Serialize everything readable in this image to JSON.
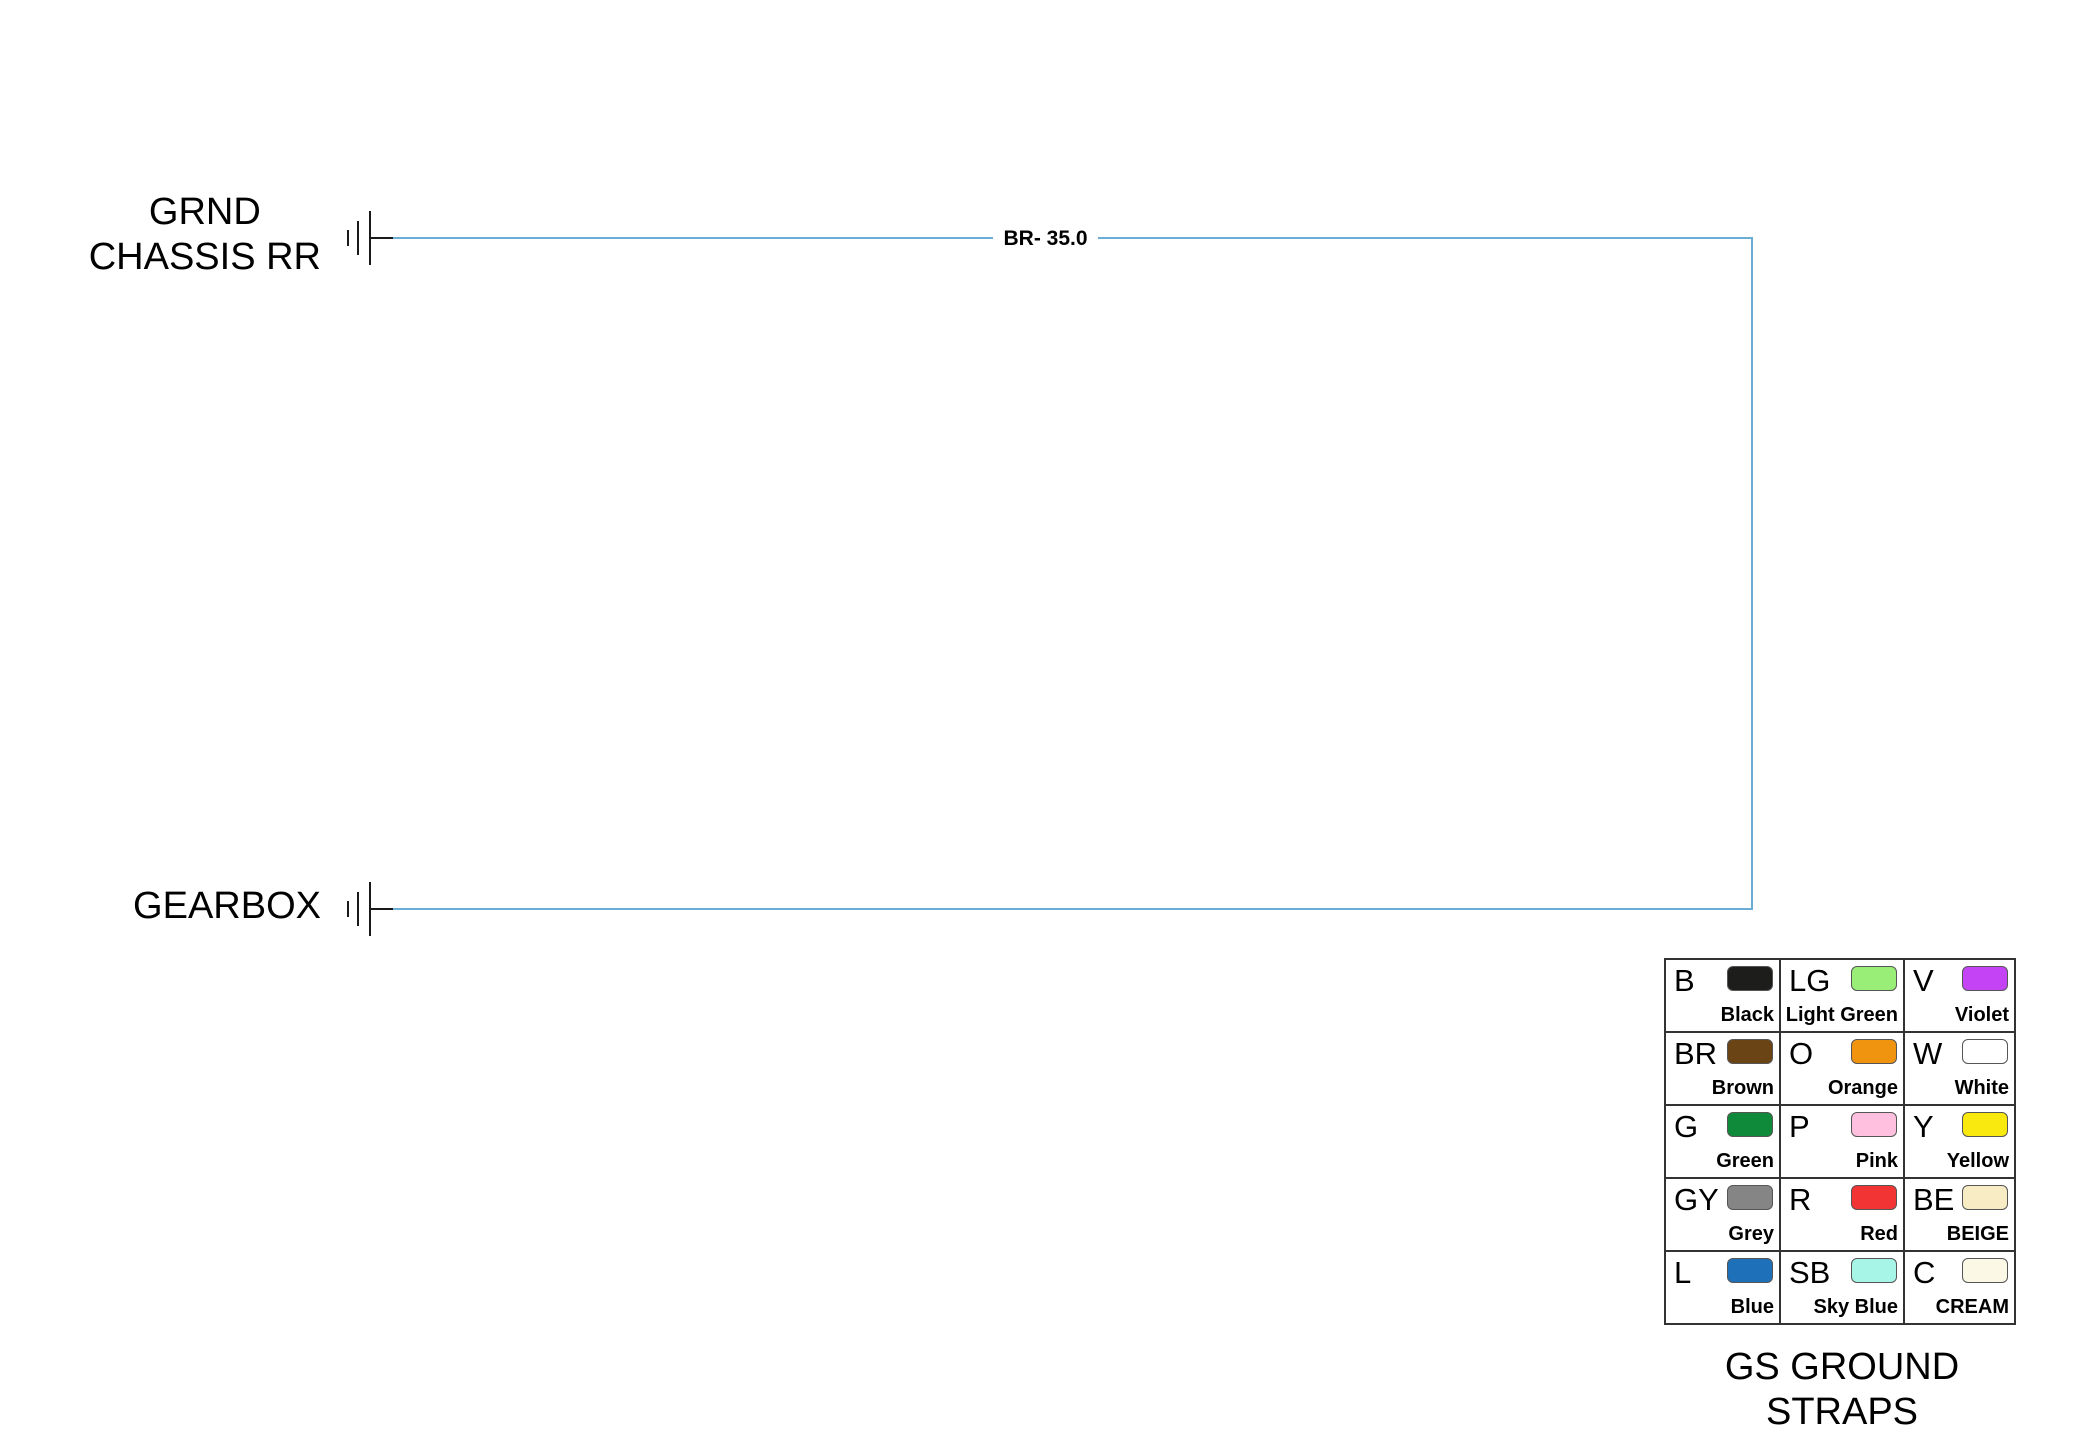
{
  "connectors": {
    "grnd": {
      "line1": "GRND",
      "line2": "CHASSIS RR"
    },
    "gearbox": {
      "label": "GEARBOX"
    }
  },
  "wire": {
    "color_code": "BR",
    "gauge": "35.0",
    "line_color": "#6aaed6"
  },
  "legend": {
    "title_line1": "GS GROUND",
    "title_line2": "STRAPS",
    "rows": [
      [
        {
          "code": "B",
          "name": "Black",
          "color": "#1d1d1b"
        },
        {
          "code": "LG",
          "name": "Light Green",
          "color": "#99ee77"
        },
        {
          "code": "V",
          "name": "Violet",
          "color": "#c444f5"
        }
      ],
      [
        {
          "code": "BR",
          "name": "Brown",
          "color": "#6b4416"
        },
        {
          "code": "O",
          "name": "Orange",
          "color": "#f0930f"
        },
        {
          "code": "W",
          "name": "White",
          "color": "#ffffff"
        }
      ],
      [
        {
          "code": "G",
          "name": "Green",
          "color": "#0f8a3a"
        },
        {
          "code": "P",
          "name": "Pink",
          "color": "#ffbfdf"
        },
        {
          "code": "Y",
          "name": "Yellow",
          "color": "#f9e90f"
        }
      ],
      [
        {
          "code": "GY",
          "name": "Grey",
          "color": "#858585"
        },
        {
          "code": "R",
          "name": "Red",
          "color": "#f23434"
        },
        {
          "code": "BE",
          "name": "BEIGE",
          "color": "#f7ecc3"
        }
      ],
      [
        {
          "code": "L",
          "name": "Blue",
          "color": "#1e70b8"
        },
        {
          "code": "SB",
          "name": "Sky Blue",
          "color": "#a7f5e7"
        },
        {
          "code": "C",
          "name": "CREAM",
          "color": "#fbf8e6"
        }
      ]
    ]
  }
}
